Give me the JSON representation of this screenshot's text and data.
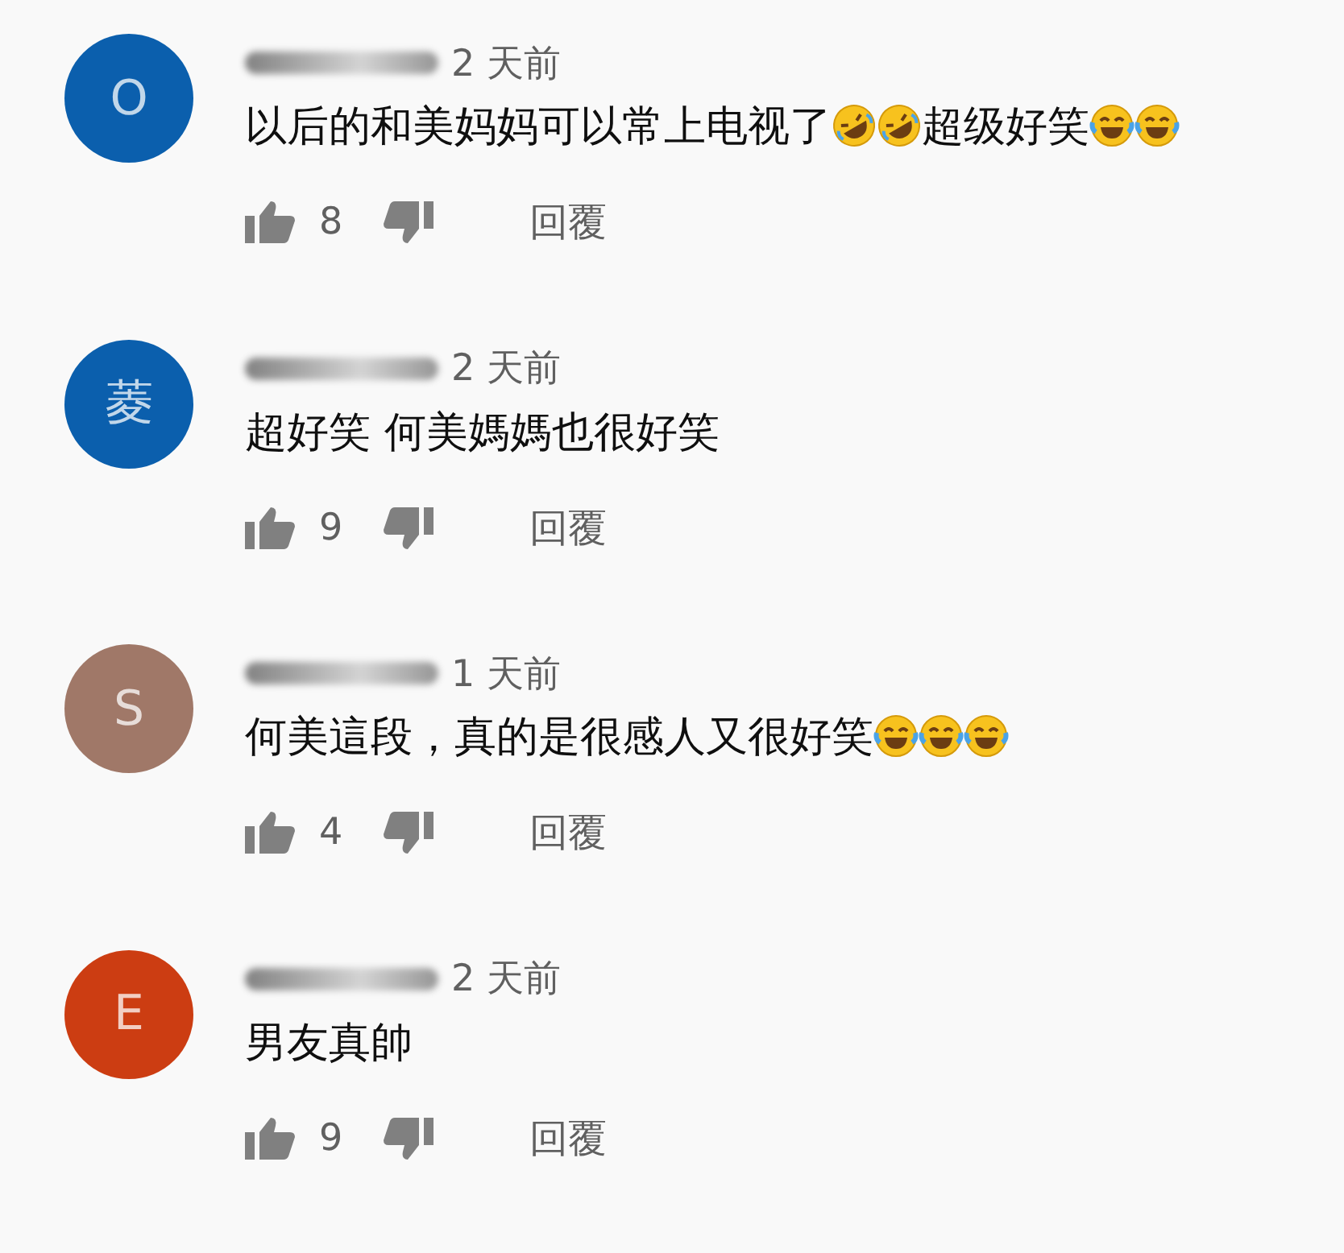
{
  "comments": [
    {
      "avatar": {
        "letter": "O",
        "color": "#0b5fad"
      },
      "time": "2 天前",
      "body": [
        {
          "kind": "text",
          "text": "以后的和美妈妈可以常上电视了"
        },
        {
          "kind": "rofl"
        },
        {
          "kind": "rofl"
        },
        {
          "kind": "text",
          "text": "超级好笑"
        },
        {
          "kind": "joy"
        },
        {
          "kind": "joy"
        }
      ],
      "likes": "8",
      "reply": "回覆"
    },
    {
      "avatar": {
        "letter": "菱",
        "color": "#0b5fad"
      },
      "time": "2 天前",
      "body": [
        {
          "kind": "text",
          "text": "超好笑 何美媽媽也很好笑"
        }
      ],
      "likes": "9",
      "reply": "回覆"
    },
    {
      "avatar": {
        "letter": "S",
        "color": "#a07868"
      },
      "time": "1 天前",
      "body": [
        {
          "kind": "text",
          "text": "何美這段，真的是很感人又很好笑"
        },
        {
          "kind": "joy"
        },
        {
          "kind": "joy"
        },
        {
          "kind": "joy"
        }
      ],
      "likes": "4",
      "reply": "回覆"
    },
    {
      "avatar": {
        "letter": "E",
        "color": "#cc3d12"
      },
      "time": "2 天前",
      "body": [
        {
          "kind": "text",
          "text": "男友真帥"
        }
      ],
      "likes": "9",
      "reply": "回覆"
    }
  ]
}
